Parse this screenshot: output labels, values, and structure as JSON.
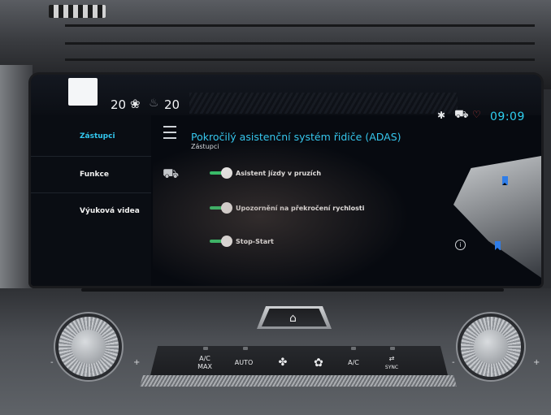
{
  "status_bar": {
    "temp_left": "20",
    "temp_right": "20",
    "fan_icon": "fan-icon",
    "seat_icon": "seat-heat-icon",
    "bluetooth_icon": "bluetooth-icon",
    "car_icon": "car-icon",
    "shield_icon": "shield-icon",
    "clock": "09:09",
    "clock_color": "#2fd0f0"
  },
  "sidebar": {
    "items": [
      {
        "label": "Zástupci",
        "active": true
      },
      {
        "label": "Funkce",
        "active": false
      },
      {
        "label": "Výuková videa",
        "active": false
      }
    ]
  },
  "header": {
    "title": "Pokročilý asistenční systém řidiče (ADAS)",
    "subtitle": "Zástupci"
  },
  "toggles": [
    {
      "label": "Asistent jízdy v pruzích",
      "on": true
    },
    {
      "label": "Upozornění na překročení rychlosti",
      "on": true
    },
    {
      "label": "Stop-Start",
      "on": true
    }
  ],
  "climate": {
    "buttons": [
      {
        "label": "A/C\nMAX",
        "icon": ""
      },
      {
        "label": "AUTO",
        "icon": ""
      },
      {
        "label": "",
        "icon": "fan-low-icon"
      },
      {
        "label": "",
        "icon": "fan-high-icon"
      },
      {
        "label": "A/C",
        "icon": ""
      },
      {
        "label": "SYNC",
        "icon": "sync-icon"
      }
    ],
    "knob_minus": "-",
    "knob_plus": "+"
  },
  "colors": {
    "accent": "#32c7ef",
    "toggle_on": "#2ec86a",
    "bookmark": "#2f7de8"
  }
}
